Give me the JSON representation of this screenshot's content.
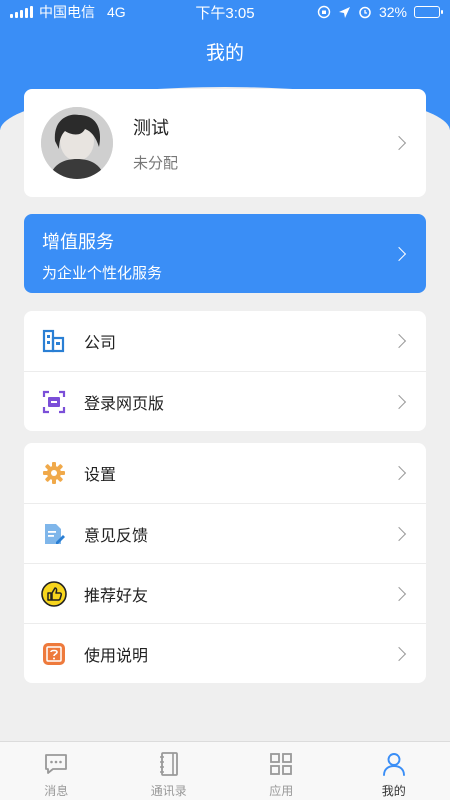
{
  "status_bar": {
    "carrier": "中国电信",
    "network": "4G",
    "time": "下午3:05",
    "battery": "32%",
    "battery_level": 0.32
  },
  "header": {
    "title": "我的"
  },
  "profile": {
    "name": "测试",
    "department": "未分配"
  },
  "vip_banner": {
    "title": "增值服务",
    "subtitle": "为企业个性化服务"
  },
  "group1": {
    "items": [
      {
        "label": "公司",
        "icon": "company-building-icon"
      },
      {
        "label": "登录网页版",
        "icon": "scan-web-login-icon"
      }
    ]
  },
  "group2": {
    "items": [
      {
        "label": "设置",
        "icon": "gear-icon"
      },
      {
        "label": "意见反馈",
        "icon": "feedback-edit-icon"
      },
      {
        "label": "推荐好友",
        "icon": "thumbs-up-icon"
      },
      {
        "label": "使用说明",
        "icon": "help-manual-icon"
      }
    ]
  },
  "tab_bar": {
    "tabs": [
      {
        "label": "消息",
        "icon": "chat-bubble-icon"
      },
      {
        "label": "通讯录",
        "icon": "contacts-book-icon"
      },
      {
        "label": "应用",
        "icon": "apps-grid-icon"
      },
      {
        "label": "我的",
        "icon": "person-icon",
        "active": true
      }
    ]
  },
  "colors": {
    "accent": "#3a8ef6",
    "background": "#efefef"
  }
}
